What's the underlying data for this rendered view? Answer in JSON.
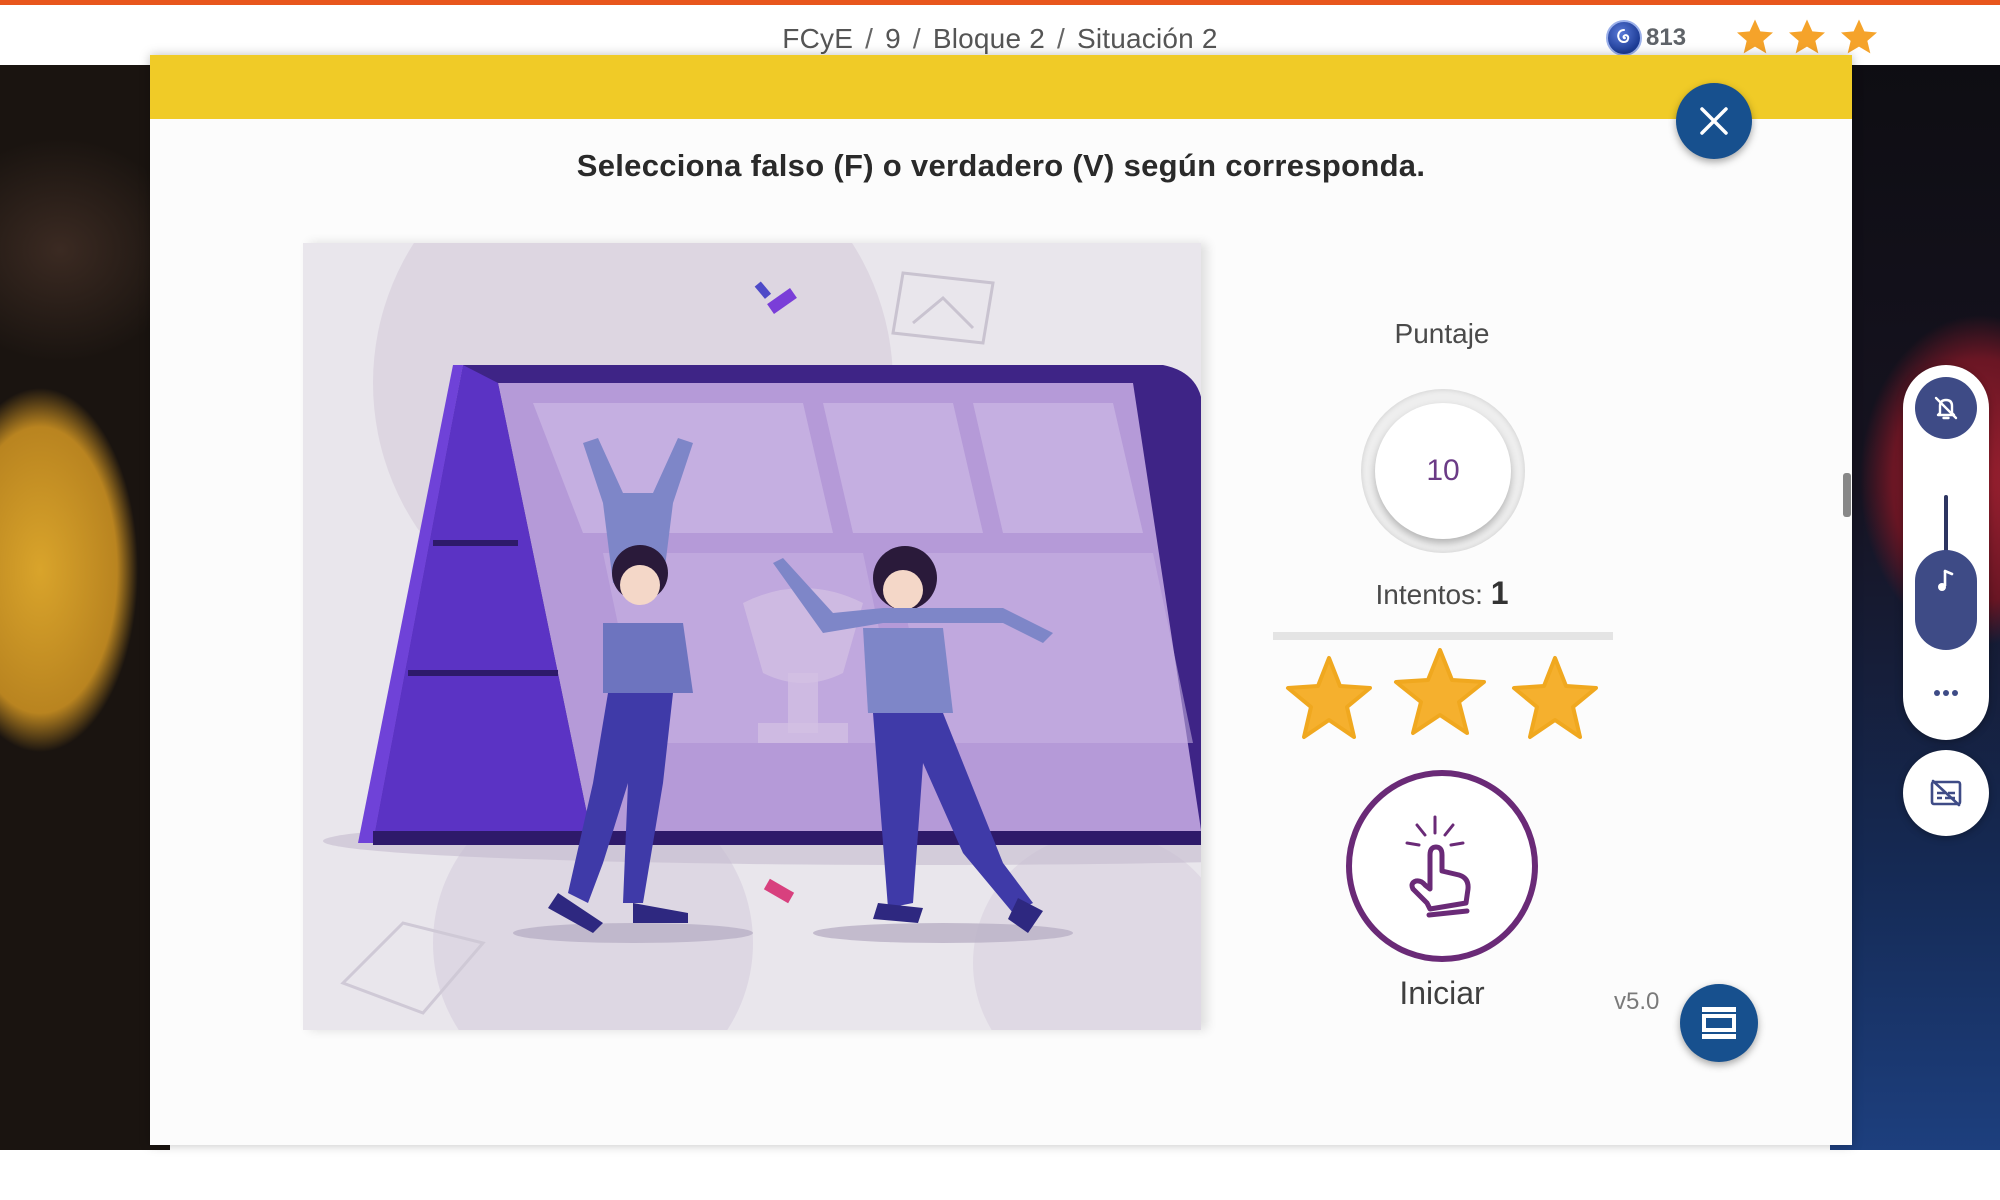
{
  "breadcrumb": {
    "items": [
      "FCyE",
      "9",
      "Bloque 2",
      "Situación 2"
    ],
    "separator": "/"
  },
  "header": {
    "coins": "813",
    "stars_earned": 3
  },
  "activity": {
    "instruction": "Selecciona falso (F) o verdadero (V) según corresponda.",
    "score_label": "Puntaje",
    "score_value": "10",
    "attempts_label": "Intentos:",
    "attempts_value": "1",
    "stars_earned": 3,
    "start_label": "Iniciar",
    "version": "v5.0"
  },
  "colors": {
    "top_accent": "#e8561d",
    "banner_yellow": "#f0cb27",
    "primary_blue": "#17508e",
    "star_gold": "#f5b02e",
    "start_purple": "#6a2a77",
    "control_indigo": "#3e4b86"
  },
  "icons": {
    "close": "close-icon",
    "coin": "coin-icon",
    "star": "star-icon",
    "tap": "tap-icon",
    "layout": "layout-icon",
    "mute": "bell-off-icon",
    "music": "music-note-icon",
    "more": "more-icon",
    "subtitles": "subtitles-off-icon"
  }
}
